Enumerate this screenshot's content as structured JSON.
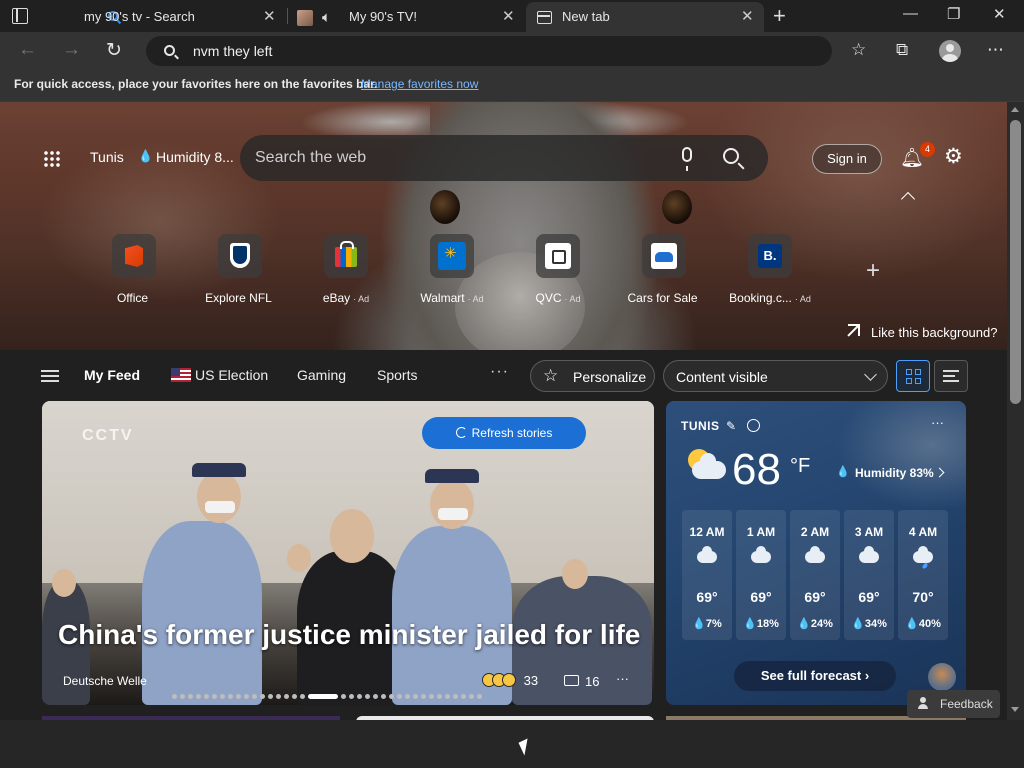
{
  "tabs": [
    {
      "title": "my 90's tv - Search",
      "close": "✕"
    },
    {
      "title": "My 90's TV!",
      "close": "✕"
    },
    {
      "title": "New tab",
      "close": "✕"
    }
  ],
  "window_controls": {
    "minimize": "—",
    "restore": "❐",
    "close": "✕"
  },
  "toolbar": {
    "back": "←",
    "forward": "→",
    "reload": "↻",
    "address": "nvm they left",
    "favorites_icon": "☆",
    "collections_icon": "⧉",
    "menu": "⋯"
  },
  "favorites_bar": {
    "message": "For quick access, place your favorites here on the favorites bar.",
    "link": "Manage favorites now"
  },
  "hero": {
    "location": "Tunis",
    "humidity": "Humidity 8...",
    "search_placeholder": "Search the web",
    "sign_in": "Sign in",
    "notifications_count": "4",
    "like_background": "Like this background?",
    "quick_links": [
      {
        "label": "Office",
        "ad": "",
        "icon": "office-icon"
      },
      {
        "label": "Explore NFL",
        "ad": "",
        "icon": "nfl-icon"
      },
      {
        "label": "eBay",
        "ad": "· Ad",
        "icon": "ebay-icon"
      },
      {
        "label": "Walmart",
        "ad": "· Ad",
        "icon": "walmart-icon"
      },
      {
        "label": "QVC",
        "ad": "· Ad",
        "icon": "qvc-icon"
      },
      {
        "label": "Cars for Sale",
        "ad": "",
        "icon": "cars-icon"
      },
      {
        "label": "Booking.c...",
        "ad": "· Ad",
        "icon": "booking-icon"
      }
    ],
    "booking_letter": "B."
  },
  "feed_nav": {
    "my_feed": "My Feed",
    "items": [
      "US Election",
      "Gaming",
      "Sports"
    ],
    "more": "···",
    "personalize": "Personalize",
    "content_visible": "Content visible"
  },
  "story": {
    "watermark": "CCTV",
    "refresh": "Refresh stories",
    "headline": "China's former justice minister jailed for life",
    "source": "Deutsche Welle",
    "reactions_count": "33",
    "comments_count": "16",
    "more": "···",
    "carousel_total": 36,
    "carousel_active": 17
  },
  "weather": {
    "city": "TUNIS",
    "temp": "68",
    "unit": "°F",
    "humidity": "Humidity 83%",
    "more": "···",
    "hourly": [
      {
        "time": "12 AM",
        "icon": "cloudy",
        "temp": "69°",
        "precip": "💧7%"
      },
      {
        "time": "1 AM",
        "icon": "cloudy",
        "temp": "69°",
        "precip": "💧18%"
      },
      {
        "time": "2 AM",
        "icon": "cloudy",
        "temp": "69°",
        "precip": "💧24%"
      },
      {
        "time": "3 AM",
        "icon": "partly-sunny",
        "temp": "69°",
        "precip": "💧34%"
      },
      {
        "time": "4 AM",
        "icon": "rain",
        "temp": "70°",
        "precip": "💧40%"
      }
    ],
    "see_forecast": "See full forecast ›"
  },
  "feedback": "Feedback"
}
